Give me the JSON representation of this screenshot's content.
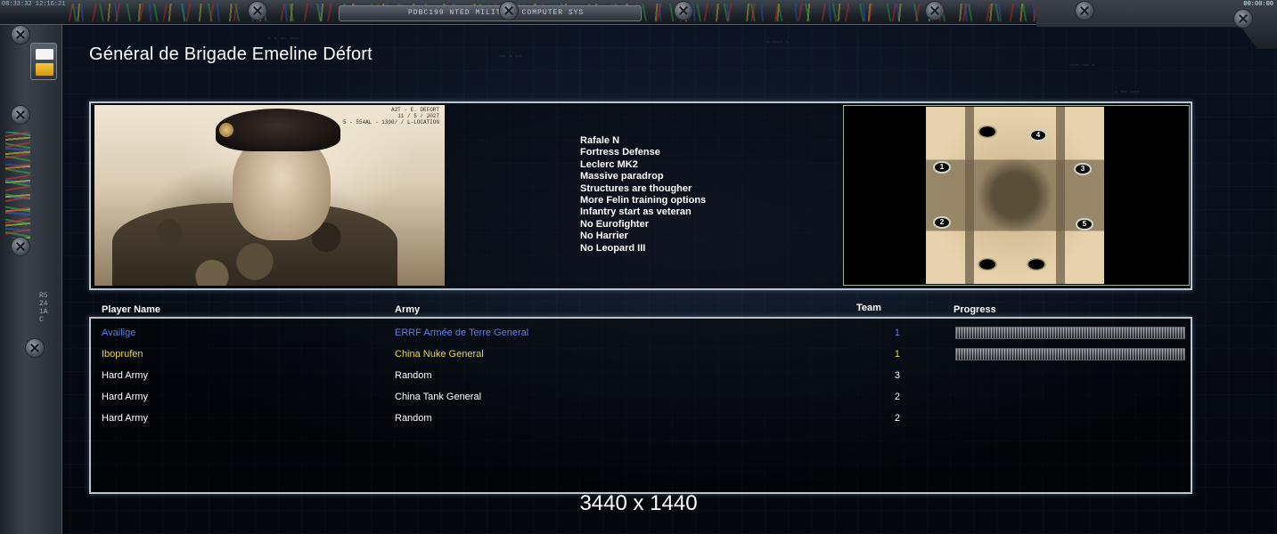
{
  "system_title": "PDBC199 NTED MILITARY COMPUTER SYS",
  "clock_left": "08:33:32 12:16:21",
  "clock_right": "00:00:00",
  "rail_label": "R5241AC",
  "general": {
    "name": "Général de Brigade Emeline Défort",
    "portrait_stamp": [
      "A2T - E. DEFORT",
      "11 / 5 / 2027",
      "5 - 554AL - 1300/ / L-LOCATION"
    ]
  },
  "rules": [
    "Rafale N",
    "Fortress Defense",
    "Leclerc MK2",
    "Massive paradrop",
    "Structures are thougher",
    "More Felin training options",
    "Infantry start as veteran",
    "No Eurofighter",
    "No Harrier",
    "No Leopard III"
  ],
  "minimap": {
    "start_positions": [
      "1",
      "2",
      "3",
      "4",
      "5"
    ]
  },
  "table": {
    "headers": {
      "player": "Player Name",
      "army": "Army",
      "team": "Team",
      "progress": "Progress"
    },
    "rows": [
      {
        "player": "Availige",
        "army": "ERRF Armée de Terre General",
        "team": "1",
        "color": "#5b7fe6",
        "progress": 1.0
      },
      {
        "player": "Iboprufen",
        "army": "China Nuke General",
        "team": "1",
        "color": "#e6d84a",
        "progress": 1.0
      },
      {
        "player": "Hard Army",
        "army": "Random",
        "team": "3",
        "color": "#ffffff"
      },
      {
        "player": "Hard Army",
        "army": "China Tank General",
        "team": "2",
        "color": "#ffffff"
      },
      {
        "player": "Hard Army",
        "army": "Random",
        "team": "2",
        "color": "#ffffff"
      }
    ]
  },
  "resolution_label": "3440 x 1440"
}
